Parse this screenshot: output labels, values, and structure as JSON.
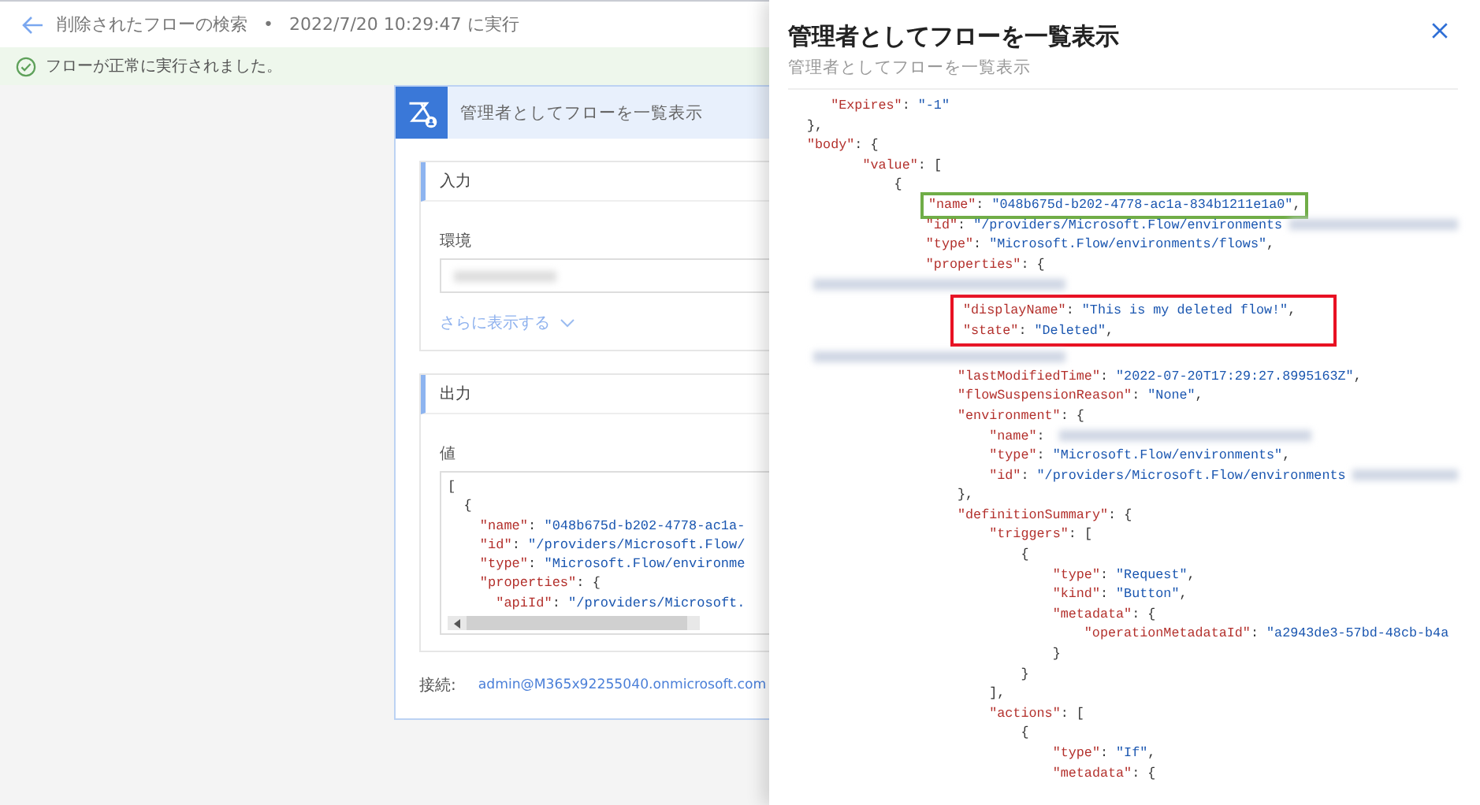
{
  "header": {
    "title": "削除されたフローの検索",
    "separator": "•",
    "run_time": "2022/7/20 10:29:47 に実行"
  },
  "banner": {
    "message": "フローが正常に実行されました。"
  },
  "card": {
    "title": "管理者としてフローを一覧表示",
    "input_section": {
      "heading": "入力",
      "field_label": "環境",
      "show_more": "さらに表示する"
    },
    "output_section": {
      "heading": "出力",
      "value_label": "値",
      "code_lines": [
        "[",
        "  {",
        "    \"name\": \"048b675d-b202-4778-ac1a-",
        "    \"id\": \"/providers/Microsoft.Flow/",
        "    \"type\": \"Microsoft.Flow/environme",
        "    \"properties\": {",
        "      \"apiId\": \"/providers/Microsoft."
      ]
    },
    "connection_label": "接続:",
    "connection_value": "admin@M365x92255040.onmicrosoft.com"
  },
  "panel": {
    "title": "管理者としてフローを一覧表示",
    "subtitle": "管理者としてフローを一覧表示",
    "code": [
      {
        "kind": "line",
        "text": "   \"Expires\": \"-1\""
      },
      {
        "kind": "line",
        "text": "},"
      },
      {
        "kind": "line",
        "text": "\"body\": {"
      },
      {
        "kind": "line",
        "text": "       \"value\": ["
      },
      {
        "kind": "line",
        "text": "           {"
      },
      {
        "kind": "box",
        "color": "#70ad47",
        "lines": [
          {
            "kind": "line",
            "text": "               \"name\": \"048b675d-b202-4778-ac1a-834b1211e1a0\","
          }
        ]
      },
      {
        "kind": "line",
        "text": "               \"id\": \"/providers/Microsoft.Flow/environments",
        "blurred": true
      },
      {
        "kind": "line",
        "text": "               \"type\": \"Microsoft.Flow/environments/flows\","
      },
      {
        "kind": "line",
        "text": "               \"properties\": {"
      },
      {
        "kind": "blurred_line"
      },
      {
        "kind": "box",
        "color": "#e81123",
        "lines": [
          {
            "kind": "line",
            "text": "                   \"displayName\": \"This is my deleted flow!\","
          },
          {
            "kind": "line",
            "text": "                   \"state\": \"Deleted\","
          }
        ]
      },
      {
        "kind": "blurred_line"
      },
      {
        "kind": "line",
        "text": "                   \"lastModifiedTime\": \"2022-07-20T17:29:27.8995163Z\","
      },
      {
        "kind": "line",
        "text": "                   \"flowSuspensionReason\": \"None\","
      },
      {
        "kind": "line",
        "text": "                   \"environment\": {"
      },
      {
        "kind": "line",
        "text": "                       \"name\": ",
        "blurred": true
      },
      {
        "kind": "line",
        "text": "                       \"type\": \"Microsoft.Flow/environments\","
      },
      {
        "kind": "line",
        "text": "                       \"id\": \"/providers/Microsoft.Flow/environments",
        "blurred": true
      },
      {
        "kind": "line",
        "text": "                   },"
      },
      {
        "kind": "line",
        "text": "                   \"definitionSummary\": {"
      },
      {
        "kind": "line",
        "text": "                       \"triggers\": ["
      },
      {
        "kind": "line",
        "text": "                           {"
      },
      {
        "kind": "line",
        "text": "                               \"type\": \"Request\","
      },
      {
        "kind": "line",
        "text": "                               \"kind\": \"Button\","
      },
      {
        "kind": "line",
        "text": "                               \"metadata\": {"
      },
      {
        "kind": "line",
        "text": "                                   \"operationMetadataId\": \"a2943de3-57bd-48cb-b4a"
      },
      {
        "kind": "line",
        "text": "                               }"
      },
      {
        "kind": "line",
        "text": "                           }"
      },
      {
        "kind": "line",
        "text": "                       ],"
      },
      {
        "kind": "line",
        "text": "                       \"actions\": ["
      },
      {
        "kind": "line",
        "text": "                           {"
      },
      {
        "kind": "line",
        "text": "                               \"type\": \"If\","
      },
      {
        "kind": "line",
        "text": "                               \"metadata\": {"
      }
    ]
  }
}
